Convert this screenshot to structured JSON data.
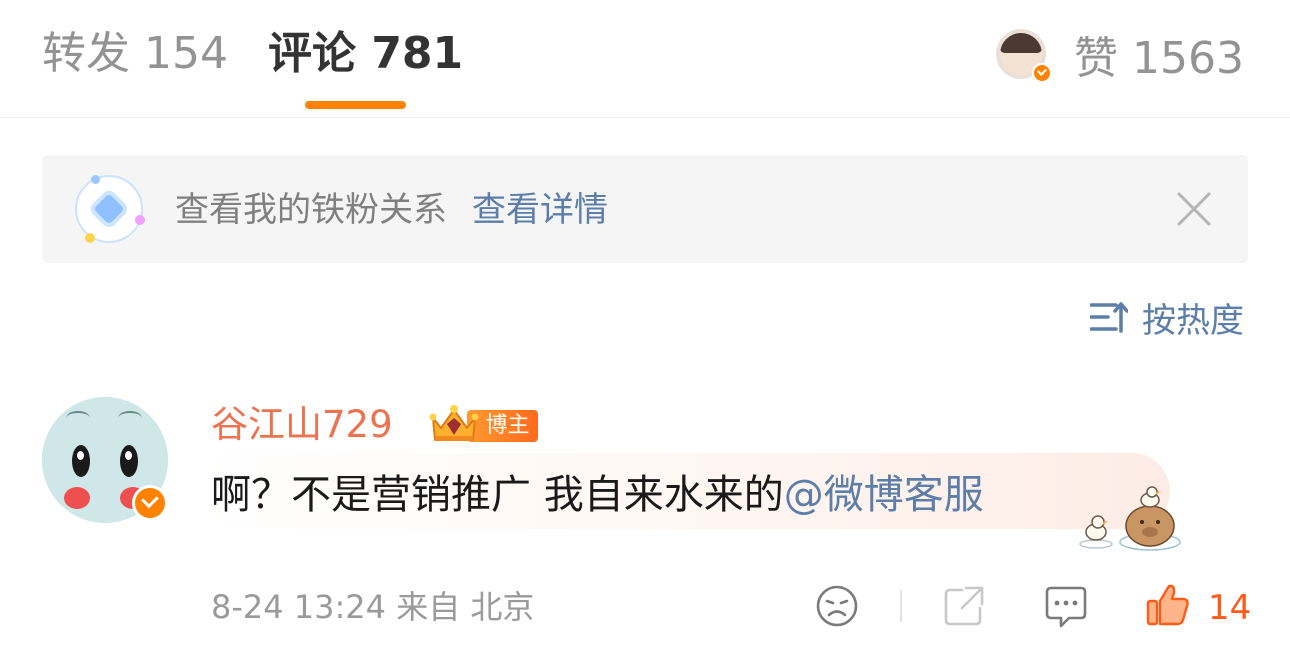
{
  "tabs": {
    "repost": "转发 154",
    "comment": "评论 781",
    "like": "赞 1563"
  },
  "fan_banner": {
    "text": "查看我的铁粉关系",
    "link": "查看详情"
  },
  "sort": {
    "label": "按热度"
  },
  "comment": {
    "username": "谷江山729",
    "badge": "博主",
    "text": "啊？不是营销推广 我自来水来的",
    "mention": "@微博客服",
    "date": "8-24 13:24",
    "source": "来自 北京",
    "like_count": "14"
  },
  "colors": {
    "accent": "#ff8200",
    "link": "#5c7ea8",
    "username": "#eb7350",
    "like_active": "#ff5a17"
  },
  "icons": [
    "verified-icon",
    "fan-gem-icon",
    "close-icon",
    "sort-icon",
    "crown-badge-icon",
    "sad-face-icon",
    "share-icon",
    "comment-icon",
    "thumbs-up-icon"
  ]
}
